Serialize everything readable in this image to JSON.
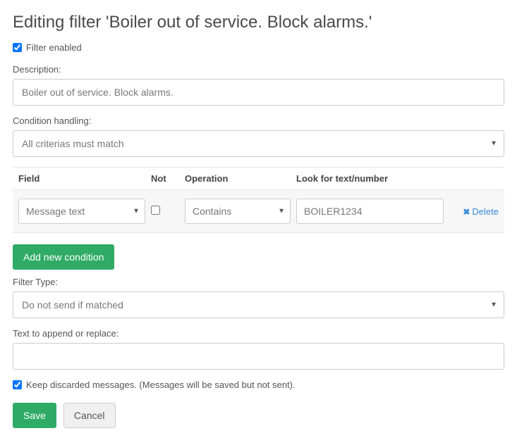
{
  "title": "Editing filter 'Boiler out of service. Block alarms.'",
  "filter_enabled": {
    "label": "Filter enabled",
    "checked": true
  },
  "description": {
    "label": "Description:",
    "value": "Boiler out of service. Block alarms."
  },
  "condition_handling": {
    "label": "Condition handling:",
    "value": "All criterias must match"
  },
  "cond_headers": {
    "field": "Field",
    "not": "Not",
    "operation": "Operation",
    "lookfor": "Look for text/number"
  },
  "condition_rows": [
    {
      "field": "Message text",
      "not": false,
      "operation": "Contains",
      "value": "BOILER1234"
    }
  ],
  "delete_label": "Delete",
  "add_condition_label": "Add new condition",
  "filter_type": {
    "label": "Filter Type:",
    "value": "Do not send if matched"
  },
  "append_text": {
    "label": "Text to append or replace:",
    "value": ""
  },
  "keep_discarded": {
    "label": "Keep discarded messages. (Messages will be saved but not sent).",
    "checked": true
  },
  "save_label": "Save",
  "cancel_label": "Cancel"
}
